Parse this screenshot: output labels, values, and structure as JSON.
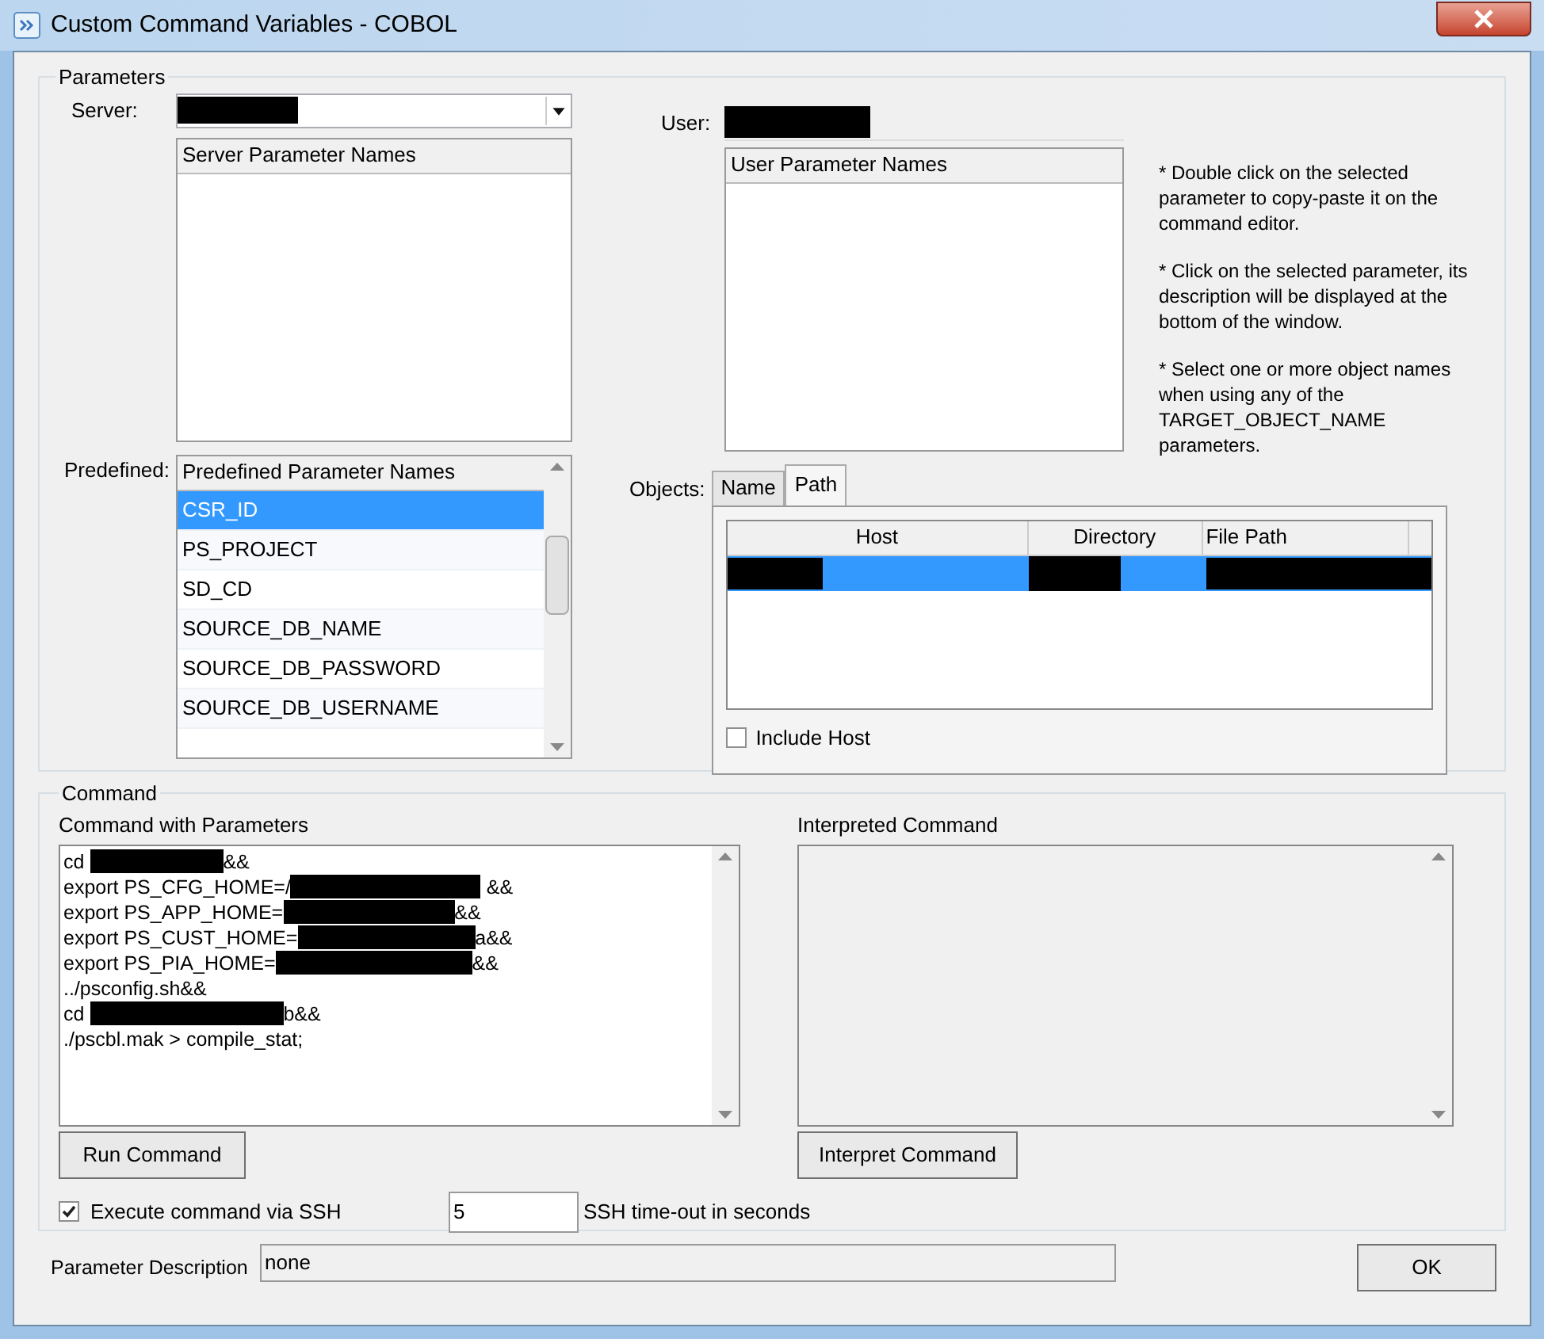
{
  "window": {
    "title": "Custom Command Variables - COBOL"
  },
  "parameters": {
    "legend": "Parameters",
    "server": {
      "label": "Server:",
      "value_redacted": true
    },
    "user": {
      "label": "User:",
      "value_redacted": true
    },
    "server_list": {
      "header": "Server Parameter Names"
    },
    "user_list": {
      "header": "User Parameter Names"
    },
    "notes": [
      "* Double click on the selected parameter to copy-paste it on the command editor.",
      "* Click on the selected parameter, its description will be displayed at the bottom of the window.",
      "* Select one or more object names when using any of the TARGET_OBJECT_NAME parameters."
    ],
    "predefined": {
      "label": "Predefined:",
      "header": "Predefined Parameter Names",
      "items": [
        {
          "name": "CSR_ID",
          "selected": true
        },
        {
          "name": "PS_PROJECT",
          "selected": false
        },
        {
          "name": "SD_CD",
          "selected": false
        },
        {
          "name": "SOURCE_DB_NAME",
          "selected": false
        },
        {
          "name": "SOURCE_DB_PASSWORD",
          "selected": false
        },
        {
          "name": "SOURCE_DB_USERNAME",
          "selected": false
        }
      ]
    },
    "objects": {
      "label": "Objects:",
      "tabs": [
        {
          "label": "Name",
          "selected": false
        },
        {
          "label": "Path",
          "selected": true
        }
      ],
      "table": {
        "columns": [
          "Host",
          "Directory",
          "File Path"
        ],
        "rows": [
          {
            "selected": true,
            "cells_redacted": true
          }
        ]
      },
      "include_host": {
        "label": "Include Host",
        "checked": false
      }
    }
  },
  "command": {
    "legend": "Command",
    "editor": {
      "label": "Command with Parameters",
      "lines": [
        [
          {
            "kind": "text",
            "text": "cd "
          },
          {
            "kind": "redacted"
          },
          {
            "kind": "text",
            "text": "&&"
          }
        ],
        [
          {
            "kind": "text",
            "text": "export PS_CFG_HOME=/"
          },
          {
            "kind": "redacted"
          },
          {
            "kind": "text",
            "text": " &&"
          }
        ],
        [
          {
            "kind": "text",
            "text": "export PS_APP_HOME="
          },
          {
            "kind": "redacted"
          },
          {
            "kind": "text",
            "text": "&&"
          }
        ],
        [
          {
            "kind": "text",
            "text": "export PS_CUST_HOME="
          },
          {
            "kind": "redacted"
          },
          {
            "kind": "text",
            "text": "a&&"
          }
        ],
        [
          {
            "kind": "text",
            "text": "export PS_PIA_HOME="
          },
          {
            "kind": "redacted"
          },
          {
            "kind": "text",
            "text": "&&"
          }
        ],
        [
          {
            "kind": "text",
            "text": "../psconfig.sh&&"
          }
        ],
        [
          {
            "kind": "text",
            "text": "cd "
          },
          {
            "kind": "redacted"
          },
          {
            "kind": "text",
            "text": "b&&"
          }
        ],
        [
          {
            "kind": "text",
            "text": "./pscbl.mak > compile_stat;"
          }
        ]
      ]
    },
    "run_button": "Run Command",
    "interpreted": {
      "label": "Interpreted Command"
    },
    "interpret_button": "Interpret Command",
    "ssh": {
      "label": "Execute command via SSH",
      "checked": true
    },
    "timeout": {
      "value": "5",
      "label": "SSH time-out in seconds"
    }
  },
  "description": {
    "label": "Parameter Description",
    "value": "none"
  },
  "ok_button": "OK"
}
